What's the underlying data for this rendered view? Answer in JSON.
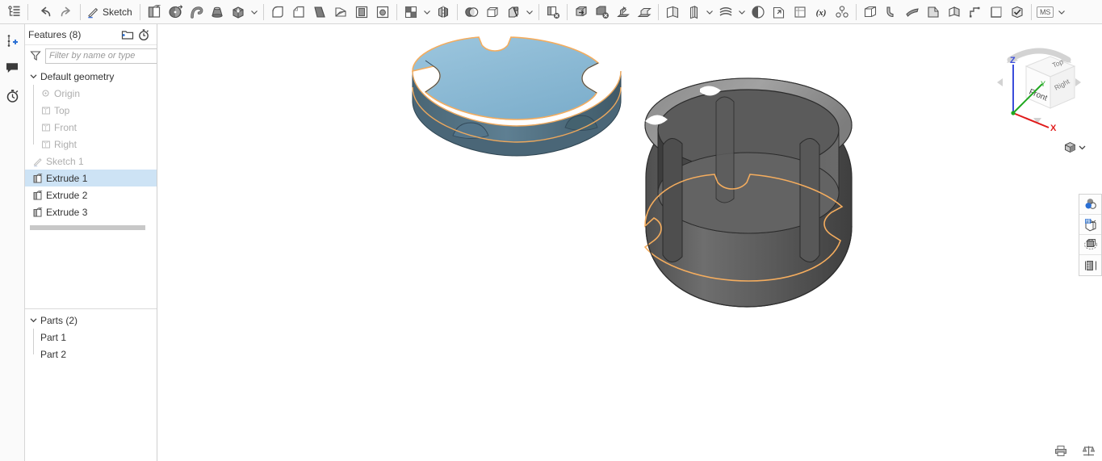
{
  "toolbar": {
    "tree_icon": "feature-tree-icon",
    "undo_label": "Undo",
    "redo_label": "Redo",
    "sketch_label": "Sketch",
    "groups": [
      {
        "name": "history",
        "items": [
          {
            "icon": "undo-icon",
            "label": "Undo"
          },
          {
            "icon": "redo-icon",
            "label": "Redo"
          }
        ]
      },
      {
        "name": "sketch",
        "items": [
          {
            "icon": "sketch-pencil-icon",
            "label": "Sketch"
          }
        ]
      },
      {
        "name": "features",
        "items": [
          {
            "icon": "extrude-icon",
            "label": "Extrude"
          },
          {
            "icon": "revolve-icon",
            "label": "Revolve"
          },
          {
            "icon": "sweep-icon",
            "label": "Sweep"
          },
          {
            "icon": "loft-icon",
            "label": "Loft"
          },
          {
            "icon": "thicken-icon",
            "label": "Thicken",
            "has_caret": true
          }
        ]
      },
      {
        "name": "modify",
        "items": [
          {
            "icon": "fillet-icon",
            "label": "Fillet"
          },
          {
            "icon": "chamfer-icon",
            "label": "Chamfer"
          },
          {
            "icon": "draft-icon",
            "label": "Draft"
          },
          {
            "icon": "rib-icon",
            "label": "Rib"
          },
          {
            "icon": "shell-icon",
            "label": "Shell"
          },
          {
            "icon": "hole-icon",
            "label": "Hole"
          }
        ]
      },
      {
        "name": "pattern",
        "items": [
          {
            "icon": "pattern-icon",
            "label": "Pattern",
            "has_caret": true
          },
          {
            "icon": "mirror-icon",
            "label": "Mirror"
          }
        ]
      },
      {
        "name": "boolean",
        "items": [
          {
            "icon": "boolean-icon",
            "label": "Boolean"
          },
          {
            "icon": "enclose-icon",
            "label": "Enclose"
          },
          {
            "icon": "split-icon",
            "label": "Split",
            "has_caret": true
          }
        ]
      },
      {
        "name": "transform",
        "items": [
          {
            "icon": "delete-face-icon",
            "label": "Delete face"
          },
          {
            "icon": "move-face-icon",
            "label": "Move face"
          },
          {
            "icon": "replace-face-icon",
            "label": "Replace face"
          },
          {
            "icon": "delete-part-icon",
            "label": "Delete part"
          },
          {
            "icon": "transform-icon",
            "label": "Transform"
          },
          {
            "icon": "sheetmetal-icon",
            "label": "Sheet metal"
          }
        ]
      },
      {
        "name": "construct",
        "items": [
          {
            "icon": "plane-icon",
            "label": "Plane"
          },
          {
            "icon": "axis-icon",
            "label": "Axis",
            "has_caret": true
          },
          {
            "icon": "curve-icon",
            "label": "Curve",
            "has_caret": true
          },
          {
            "icon": "mate-connector-icon",
            "label": "Mate connector"
          },
          {
            "icon": "import-icon",
            "label": "Import derived"
          }
        ]
      },
      {
        "name": "assembly",
        "items": [
          {
            "icon": "composite-part-icon",
            "label": "Composite part"
          },
          {
            "icon": "variable-icon",
            "label": "Variable"
          },
          {
            "icon": "assembly-icon",
            "label": "Assembly"
          }
        ]
      },
      {
        "name": "sheetmetal",
        "items": [
          {
            "icon": "sm-base-icon",
            "label": "Sheet metal base"
          },
          {
            "icon": "sm-flange-icon",
            "label": "Flange"
          },
          {
            "icon": "sm-bend-icon",
            "label": "Bend"
          },
          {
            "icon": "sm-tab-icon",
            "label": "Tab"
          },
          {
            "icon": "sm-unfold-icon",
            "label": "Unfold"
          },
          {
            "icon": "sm-joint-icon",
            "label": "Joint"
          },
          {
            "icon": "sm-corner-icon",
            "label": "Corner"
          },
          {
            "icon": "sm-check-icon",
            "label": "Check"
          }
        ]
      }
    ],
    "version_button": "MS"
  },
  "left_rail": {
    "items": [
      {
        "icon": "instance-add-icon",
        "label": "Insert instance"
      },
      {
        "icon": "comment-icon",
        "label": "Comments"
      },
      {
        "icon": "history-icon",
        "label": "Version history"
      }
    ]
  },
  "tree": {
    "title": "Features (8)",
    "header_icons": [
      {
        "icon": "new-folder-icon",
        "label": "New folder"
      },
      {
        "icon": "rollback-timer-icon",
        "label": "Feature rollback"
      }
    ],
    "filter_placeholder": "Filter by name or type",
    "filter_value": "",
    "filter_icon": "filter-funnel-icon",
    "items": [
      {
        "label": "Default geometry",
        "icon": "folder-caret",
        "level": 0,
        "dim": false,
        "expanded": true,
        "selected": false
      },
      {
        "label": "Origin",
        "icon": "origin-icon",
        "level": 1,
        "dim": true,
        "selected": false
      },
      {
        "label": "Top",
        "icon": "plane-icon",
        "level": 1,
        "dim": true,
        "selected": false
      },
      {
        "label": "Front",
        "icon": "plane-icon",
        "level": 1,
        "dim": true,
        "selected": false
      },
      {
        "label": "Right",
        "icon": "plane-icon",
        "level": 1,
        "dim": true,
        "selected": false
      },
      {
        "label": "Sketch 1",
        "icon": "sketch-icon",
        "level": 0,
        "dim": true,
        "selected": false
      },
      {
        "label": "Extrude 1",
        "icon": "extrude-icon",
        "level": 0,
        "dim": false,
        "selected": true
      },
      {
        "label": "Extrude 2",
        "icon": "extrude-icon",
        "level": 0,
        "dim": false,
        "selected": false
      },
      {
        "label": "Extrude 3",
        "icon": "extrude-icon",
        "level": 0,
        "dim": false,
        "selected": false
      }
    ],
    "parts": {
      "title": "Parts (2)",
      "items": [
        {
          "label": "Part 1"
        },
        {
          "label": "Part 2"
        }
      ]
    },
    "list_toggle_icon": "feature-list-icon"
  },
  "viewcube": {
    "face_top": "Top",
    "face_front": "Front",
    "face_right": "Right",
    "axis_x": "X",
    "axis_y": "Y",
    "axis_z": "Z",
    "axis_x_color": "#e01b1b",
    "axis_y_color": "#1fa81f",
    "axis_z_color": "#3b4ddb",
    "display_mode_icon": "shaded-cube-icon"
  },
  "right_tools": {
    "items": [
      {
        "icon": "appearance-icon",
        "label": "Appearance"
      },
      {
        "icon": "section-view-icon",
        "label": "Section view"
      },
      {
        "icon": "hidden-edges-icon",
        "label": "Hidden edges visible"
      },
      {
        "icon": "measure-display-icon",
        "label": "Display measurements"
      }
    ]
  },
  "status_bar": {
    "icons": [
      {
        "icon": "print-icon",
        "label": "Print"
      },
      {
        "icon": "units-scale-icon",
        "label": "Units"
      }
    ]
  },
  "graphics": {
    "parts": [
      {
        "name": "disc-part",
        "description": "Notched circular disc, selected",
        "fill": "#8fbcd8",
        "edge_highlight": "#f5ad5e",
        "selected": true
      },
      {
        "name": "cylinder-part",
        "description": "Grooved hollow cylinder",
        "fill": "#5f5f5f",
        "edge_highlight": "#f5ad5e",
        "selected": false
      }
    ],
    "background": "#ffffff"
  }
}
